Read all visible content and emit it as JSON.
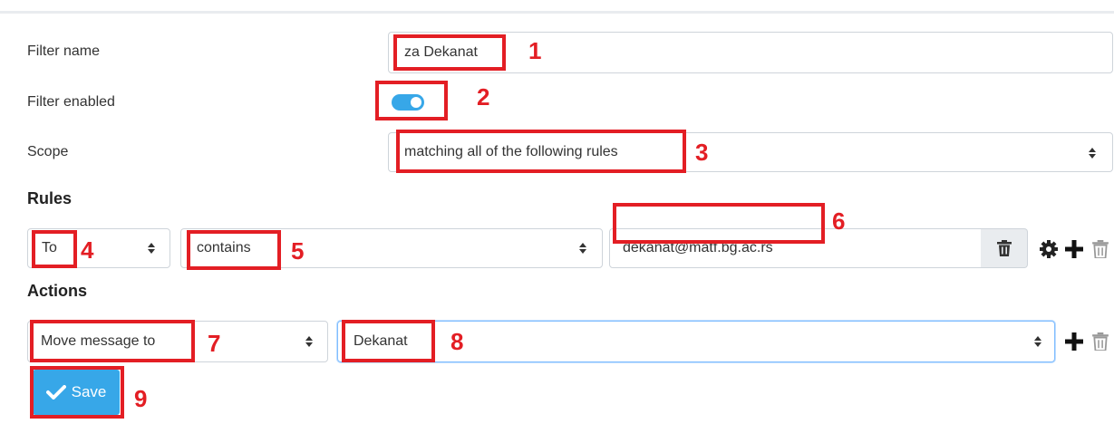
{
  "form": {
    "filter_name_label": "Filter name",
    "filter_name_value": "za Dekanat",
    "filter_enabled_label": "Filter enabled",
    "filter_enabled": true,
    "scope_label": "Scope",
    "scope_value": "matching all of the following rules"
  },
  "rules": {
    "heading": "Rules",
    "rule": {
      "header_value": "To",
      "operator_value": "contains",
      "target_value": "dekanat@matf.bg.ac.rs"
    }
  },
  "actions": {
    "heading": "Actions",
    "action": {
      "type_value": "Move message to",
      "folder_value": "Dekanat"
    }
  },
  "save": {
    "label": "Save"
  },
  "annotations": [
    "1",
    "2",
    "3",
    "4",
    "5",
    "6",
    "7",
    "8",
    "9"
  ],
  "colors": {
    "accent": "#37a7e8",
    "annotation": "#e31e24"
  },
  "icons": [
    "up-down-caret-icon",
    "trash-icon",
    "gear-icon",
    "plus-icon",
    "checkmark-icon"
  ]
}
